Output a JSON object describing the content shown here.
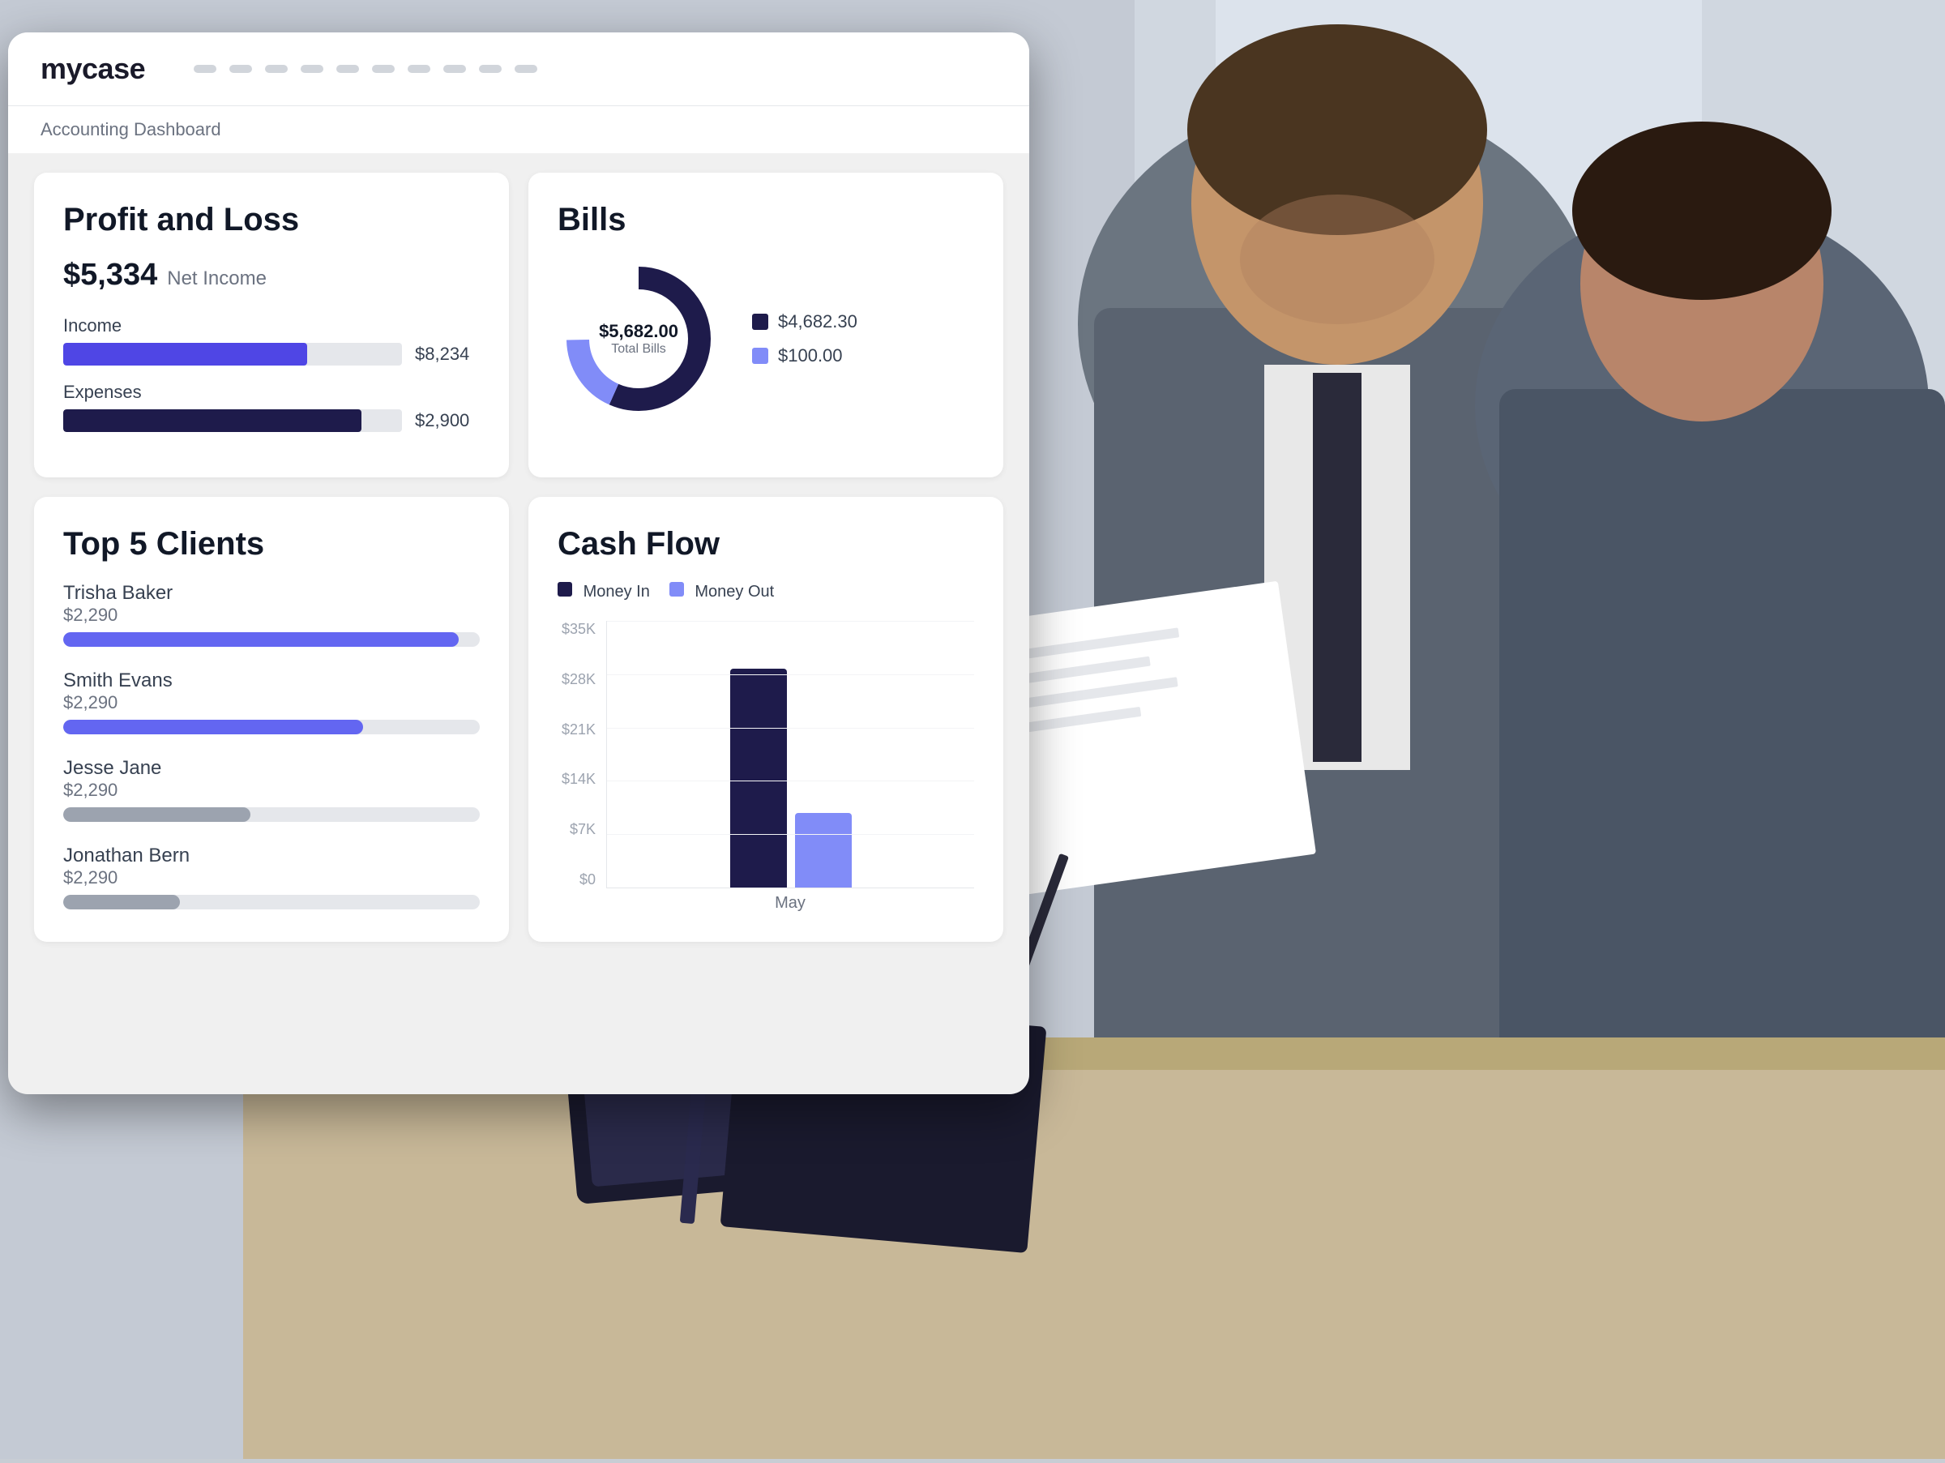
{
  "app": {
    "logo": "mycase",
    "breadcrumb": "Accounting Dashboard"
  },
  "nav_dots": [
    1,
    2,
    3,
    4,
    5,
    6,
    7,
    8,
    9,
    10
  ],
  "profit_loss": {
    "title": "Profit and Loss",
    "net_income_amount": "$5,334",
    "net_income_label": "Net Income",
    "income_label": "Income",
    "income_value": "$8,234",
    "income_pct": 72,
    "expenses_label": "Expenses",
    "expenses_value": "$2,900",
    "expenses_pct": 88
  },
  "bills": {
    "title": "Bills",
    "total_amount": "$5,682.00",
    "total_label": "Total Bills",
    "legend": [
      {
        "color": "#1e1b4b",
        "value": "$4,682.30"
      },
      {
        "color": "#6366f1",
        "value": "$100.00"
      }
    ],
    "donut_pct_dark": 82,
    "donut_pct_light": 18
  },
  "top_clients": {
    "title": "Top 5 Clients",
    "clients": [
      {
        "name": "Trisha Baker",
        "amount": "$2,290",
        "pct": 95,
        "color": "#6366f1"
      },
      {
        "name": "Smith Evans",
        "amount": "$2,290",
        "pct": 72,
        "color": "#6366f1"
      },
      {
        "name": "Jesse Jane",
        "amount": "$2,290",
        "pct": 45,
        "color": "#9ca3af"
      },
      {
        "name": "Jonathan Bern",
        "amount": "$2,290",
        "pct": 30,
        "color": "#9ca3af"
      }
    ]
  },
  "cash_flow": {
    "title": "Cash Flow",
    "legend_money_in": "Money In",
    "legend_money_out": "Money Out",
    "color_in": "#1e1b4b",
    "color_out": "#6366f1",
    "y_labels": [
      "$35K",
      "$28K",
      "$21K",
      "$14K",
      "$7K",
      "$0"
    ],
    "x_label": "May",
    "bar_in_height_pct": 82,
    "bar_out_height_pct": 28
  }
}
